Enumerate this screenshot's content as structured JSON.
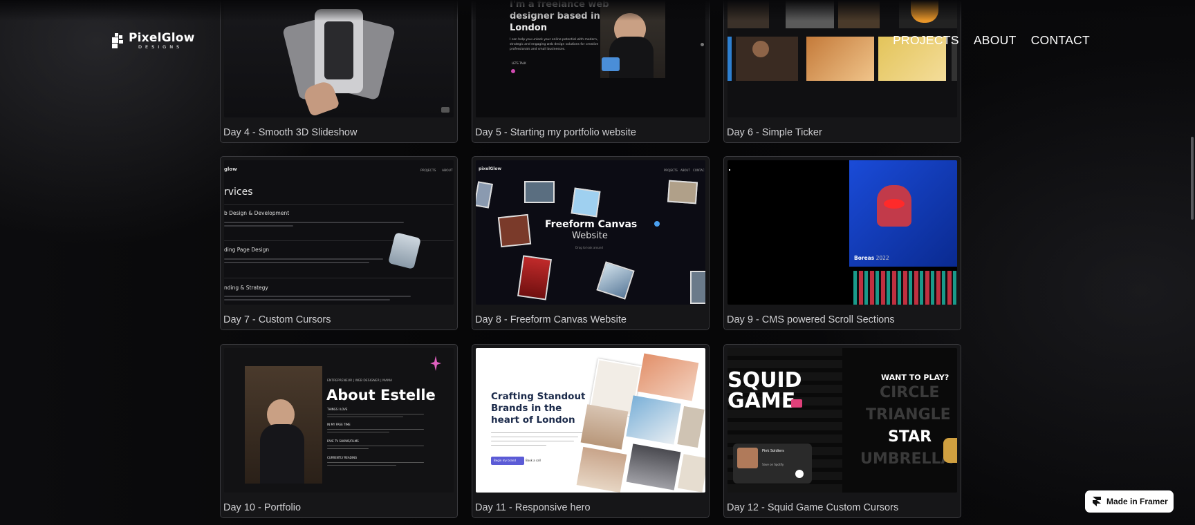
{
  "brand": {
    "name": "PixelGlow",
    "tagline": "DESIGNS"
  },
  "nav": {
    "items": [
      "PROJECTS",
      "ABOUT",
      "CONTACT"
    ]
  },
  "cards": [
    {
      "label": "Day 4 - Smooth 3D Slideshow"
    },
    {
      "label": "Day 5 - Starting my portfolio website",
      "preview": {
        "heading": [
          "I'm a freelance web",
          "designer based in",
          "London"
        ],
        "body": [
          "I can help you unlock your online potential with modern,",
          "strategic and engaging web design solutions for creative",
          "professionals and small businesses."
        ],
        "cta": "LETS TALK"
      }
    },
    {
      "label": "Day 6 - Simple Ticker"
    },
    {
      "label": "Day 7 - Custom Cursors",
      "preview": {
        "logo": "glow",
        "nav": [
          "PROJECTS",
          "ABOUT"
        ],
        "heading": "rvices",
        "sections": [
          "b Design & Development",
          "ding Page Design",
          "nding & Strategy"
        ]
      }
    },
    {
      "label": "Day 8 - Freeform Canvas Website",
      "preview": {
        "logo": "pixelGlow",
        "nav": [
          "PROJECTS",
          "ABOUT",
          "CONTAC"
        ],
        "title": "Freeform Canvas",
        "subtitle": "Website",
        "note": "Drag to look around"
      }
    },
    {
      "label": "Day 9 - CMS powered Scroll Sections",
      "preview": {
        "tag_name": "Boreas",
        "tag_year": "2022"
      }
    },
    {
      "label": "Day 10 - Portfolio",
      "preview": {
        "eyebrow": "ENTREPRENEUR | WEB DESIGNER | MAMA",
        "title": "About Estelle",
        "sections": [
          "THINGS I LOVE",
          "IN MY FREE TIME",
          "FAVE TV SHOWS/FILMS",
          "CURRENTLY READING"
        ]
      }
    },
    {
      "label": "Day 11 - Responsive hero",
      "preview": {
        "heading": [
          "Crafting Standout",
          "Brands in the",
          "heart of London"
        ],
        "primary_btn": "Begin my brand",
        "secondary_btn": "Book a call"
      }
    },
    {
      "label": "Day 12 - Squid Game Custom Cursors",
      "preview": {
        "logo": [
          "SQUID",
          "GAME"
        ],
        "prompt": "WANT TO PLAY?",
        "shapes": [
          "CIRCLE",
          "TRIANGLE",
          "STAR",
          "UMBRELLA"
        ],
        "player_title": "Pink Soldiers",
        "player_action": "Save on Spotify"
      }
    }
  ],
  "badge": {
    "label": "Made in Framer"
  }
}
